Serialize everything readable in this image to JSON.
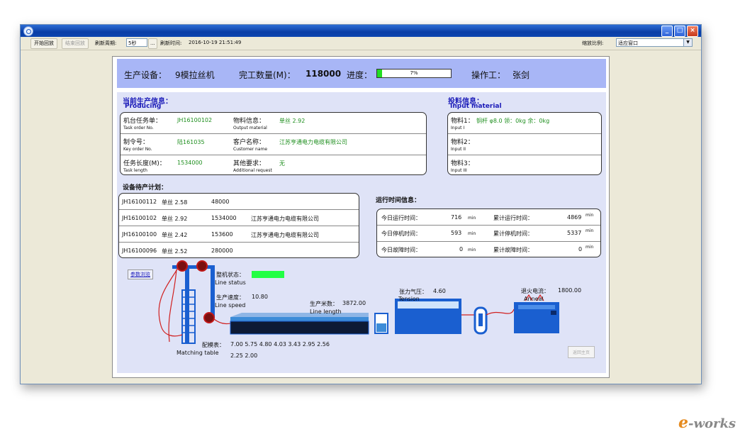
{
  "toolbar": {
    "start_label": "开始回放",
    "stop_label": "结束回放",
    "refresh_period_label": "刷新周期:",
    "refresh_period_value": "5秒",
    "more_label": "...",
    "refresh_time_label": "刷新时间:",
    "refresh_time_value": "2016-10-19 21:51:49",
    "zoom_label": "缩放比例:",
    "zoom_value": "适应窗口"
  },
  "header": {
    "equipment_label": "生产设备：",
    "equipment_value": "9模拉丝机",
    "quantity_label": "完工数量(M)：",
    "quantity_value": "118000",
    "progress_label": "进度：",
    "progress_value": 7,
    "progress_text": "7%",
    "operator_label": "操作工：",
    "operator_value": "张剑"
  },
  "producing": {
    "title": "当前生产信息：",
    "title_en": "Producing",
    "rows": [
      {
        "label": "机台任务单：",
        "label_en": "Task order No.",
        "value": "JH16100102",
        "label2": "物料信息：",
        "label2_en": "Output material",
        "value2": "单丝 2.92"
      },
      {
        "label": "制令号：",
        "label_en": "Key order No.",
        "value": "陆161035",
        "label2": "客户名称：",
        "label2_en": "Customer name",
        "value2": "江苏亨通电力电缆有限公司"
      },
      {
        "label": "任务长度(M)：",
        "label_en": "Task length",
        "value": "1534000",
        "label2": "其他要求：",
        "label2_en": "Additional request",
        "value2": "无"
      }
    ]
  },
  "input_material": {
    "title": "投料信息：",
    "title_en": "Input material",
    "rows": [
      {
        "label": "物料1：",
        "label_en": "Input I",
        "value": "铜杆 φ8.0  领：0kg  余：0kg"
      },
      {
        "label": "物料2：",
        "label_en": "Input II",
        "value": ""
      },
      {
        "label": "物料3：",
        "label_en": "Input III",
        "value": ""
      }
    ]
  },
  "plan": {
    "title": "设备待产计划：",
    "rows": [
      {
        "order": "JH16100112",
        "material": "单丝 2.58",
        "length": "48000",
        "customer": ""
      },
      {
        "order": "JH16100102",
        "material": "单丝 2.92",
        "length": "1534000",
        "customer": "江苏亨通电力电缆有限公司"
      },
      {
        "order": "JH16100100",
        "material": "单丝 2.42",
        "length": "153600",
        "customer": "江苏亨通电力电缆有限公司"
      },
      {
        "order": "JH16100096",
        "material": "单丝 2.52",
        "length": "280000",
        "customer": ""
      }
    ]
  },
  "runtime": {
    "title": "运行时间信息：",
    "rows": [
      {
        "label": "今日运行时间：",
        "value": "716",
        "unit": "min",
        "label2": "累计运行时间：",
        "value2": "4869",
        "unit2": "min"
      },
      {
        "label": "今日停机时间：",
        "value": "593",
        "unit": "min",
        "label2": "累计停机时间：",
        "value2": "5337",
        "unit2": "min"
      },
      {
        "label": "今日故障时间：",
        "value": "0",
        "unit": "min",
        "label2": "累计故障时间：",
        "value2": "0",
        "unit2": "min"
      }
    ]
  },
  "diagram": {
    "param_button": "参数浏览",
    "line_status_label": "整机状态：",
    "line_status_en": "Line status",
    "line_status_color": "#22ff44",
    "line_speed_label": "生产速度：",
    "line_speed_value": "10.80",
    "line_speed_en": "Line speed",
    "line_length_label": "生产米数：",
    "line_length_value": "3872.00",
    "line_length_en": "Line length",
    "tension_label": "张力气压：",
    "tension_value": "4.60",
    "tension_en": "Tension",
    "anneal_label": "退火电流：",
    "anneal_value": "1800.00",
    "anneal_en": "Anneal",
    "matching_label": "配模表：",
    "matching_en": "Matching table",
    "matching_values_row1": "7.00    5.75    4.80    4.03    3.43    2.95    2.56",
    "matching_values_row2": "2.25    2.00",
    "bottom_button": "返回主页"
  },
  "watermark": {
    "brand_e": "e",
    "brand_rest": "-works"
  },
  "colors": {
    "header_bg": "#a8b6f6",
    "body_bg": "#dfe3f7",
    "accent_blue": "#1a1ab8",
    "value_green": "#1f8f1f",
    "machine_blue": "#1a5fd0"
  }
}
